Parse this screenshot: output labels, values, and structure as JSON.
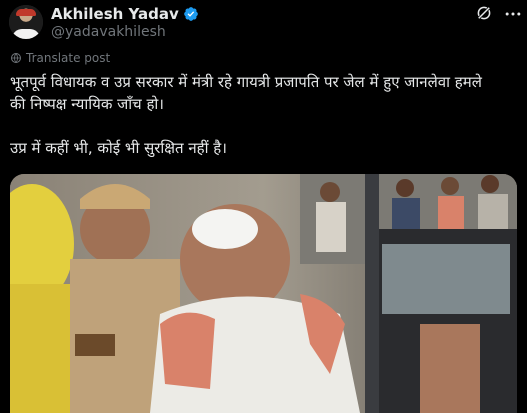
{
  "author": {
    "name": "Akhilesh Yadav",
    "handle": "@yadavakhilesh",
    "verified_icon": "verified-badge-icon",
    "verified_color": "#1d9bf0"
  },
  "actions": {
    "grok_icon": "grok-icon",
    "more_icon": "more-options-icon"
  },
  "translate": {
    "label": "Translate post",
    "icon": "globe-icon"
  },
  "post": {
    "line1": "भूतपूर्व विधायक व उप्र सरकार में मंत्री रहे गायत्री प्रजापति पर जेल में हुए जानलेवा हमले",
    "line2": "की निष्पक्ष न्यायिक जाँच हो।",
    "line3": "उप्र में कहीं भी, कोई भी सुरक्षित नहीं है।"
  },
  "media": {
    "type": "photo",
    "colors": {
      "text": "#e7e9ea",
      "muted": "#71767b",
      "background": "#000000"
    }
  }
}
